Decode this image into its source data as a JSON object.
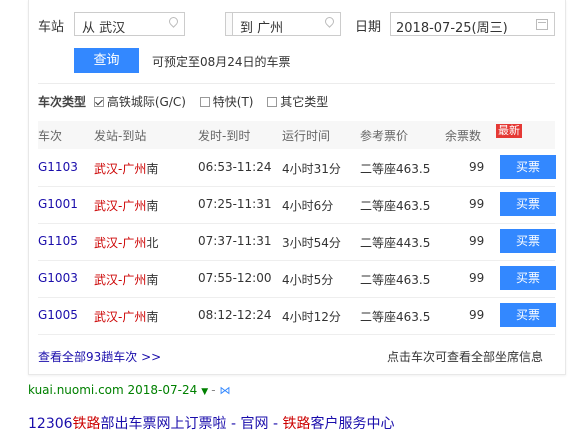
{
  "search": {
    "station_label": "车站",
    "from_value": "从 武汉",
    "to_value": "到 广州",
    "date_label": "日期",
    "date_value": "2018-07-25(周三)",
    "query_label": "查询",
    "booking_hint": "可预定至08月24日的车票"
  },
  "filters": {
    "label": "车次类型",
    "options": [
      {
        "label": "高铁城际(G/C)",
        "checked": true
      },
      {
        "label": "特快(T)",
        "checked": false
      },
      {
        "label": "其它类型",
        "checked": false
      }
    ]
  },
  "table": {
    "headers": [
      "车次",
      "发站-到站",
      "发时-到时",
      "运行时间",
      "参考票价",
      "余票数"
    ],
    "new_badge": "最新",
    "rows": [
      {
        "code": "G1103",
        "route": "武汉-广州",
        "suffix": "南",
        "time": "06:53-11:24",
        "duration": "4小时31分",
        "price": "二等座463.5",
        "remaining": "99",
        "buy": "买票"
      },
      {
        "code": "G1001",
        "route": "武汉-广州",
        "suffix": "南",
        "time": "07:25-11:31",
        "duration": "4小时6分",
        "price": "二等座463.5",
        "remaining": "99",
        "buy": "买票"
      },
      {
        "code": "G1105",
        "route": "武汉-广州",
        "suffix": "北",
        "time": "07:37-11:31",
        "duration": "3小时54分",
        "price": "二等座443.5",
        "remaining": "99",
        "buy": "买票"
      },
      {
        "code": "G1003",
        "route": "武汉-广州",
        "suffix": "南",
        "time": "07:55-12:00",
        "duration": "4小时5分",
        "price": "二等座463.5",
        "remaining": "99",
        "buy": "买票"
      },
      {
        "code": "G1005",
        "route": "武汉-广州",
        "suffix": "南",
        "time": "08:12-12:24",
        "duration": "4小时12分",
        "price": "二等座463.5",
        "remaining": "99",
        "buy": "买票"
      }
    ]
  },
  "footer": {
    "view_all": "查看全部93趟车次 >>",
    "seat_hint": "点击车次可查看全部坐席信息"
  },
  "source": {
    "text": "kuai.nuomi.com 2018-07-24",
    "dash": "-"
  },
  "next_result": {
    "prefix": "12306",
    "highlight1": "铁路",
    "middle": "部出车票网上订票啦 - 官网 - ",
    "highlight2": "铁路",
    "suffix": "客户服务中心"
  },
  "colors": {
    "accent": "#3388ff",
    "station_red": "#cc0000",
    "link_blue": "#1a0dab",
    "source_green": "#008000",
    "badge_red": "#e53935"
  }
}
